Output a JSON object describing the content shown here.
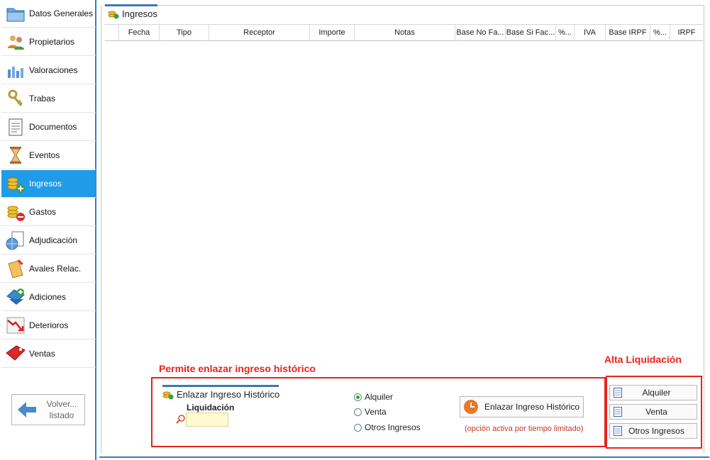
{
  "sidebar": {
    "items": [
      {
        "label": "Datos Generales",
        "icon": "folder-icon"
      },
      {
        "label": "Propietarios",
        "icon": "people-icon"
      },
      {
        "label": "Valoraciones",
        "icon": "bar-chart-icon"
      },
      {
        "label": "Trabas",
        "icon": "keys-icon"
      },
      {
        "label": "Documentos",
        "icon": "notepad-icon"
      },
      {
        "label": "Eventos",
        "icon": "hourglass-icon"
      },
      {
        "label": "Ingresos",
        "icon": "coins-add-icon",
        "active": true
      },
      {
        "label": "Gastos",
        "icon": "coins-remove-icon"
      },
      {
        "label": "Adjudicación",
        "icon": "globe-document-icon"
      },
      {
        "label": "Avales Relac.",
        "icon": "pencil-document-icon"
      },
      {
        "label": "Adiciones",
        "icon": "add-arrow-icon"
      },
      {
        "label": "Deterioros",
        "icon": "down-trend-icon"
      },
      {
        "label": "Ventas",
        "icon": "sale-tag-icon"
      }
    ],
    "back_label_1": "Volver...",
    "back_label_2": "listado"
  },
  "panel": {
    "title": "Ingresos",
    "columns": [
      "",
      "Fecha",
      "Tipo",
      "Receptor",
      "Importe",
      "Notas",
      "Base No Fa...",
      "Base Si Fac...",
      "%...",
      "IVA",
      "Base IRPF",
      "%...",
      "IRPF"
    ]
  },
  "annotations": {
    "link_note": "Permite enlazar ingreso histórico",
    "alta_note": "Alta Liquidación"
  },
  "link_section": {
    "title": "Enlazar Ingreso Histórico",
    "liquidacion_label": "Liquidación",
    "liquidacion_value": "",
    "radios": [
      {
        "label": "Alquiler",
        "checked": true
      },
      {
        "label": "Venta",
        "checked": false
      },
      {
        "label": "Otros Ingresos",
        "checked": false
      }
    ],
    "button_label": "Enlazar Ingreso Histórico",
    "note": "(opción activa por tiempo limitado)"
  },
  "alta": {
    "buttons": [
      "Alquiler",
      "Venta",
      "Otros Ingresos"
    ]
  },
  "colors": {
    "accent": "#1f9be8",
    "frame": "#3a78b8",
    "annotation": "#e8231f",
    "input_bg": "#fffbd0"
  }
}
